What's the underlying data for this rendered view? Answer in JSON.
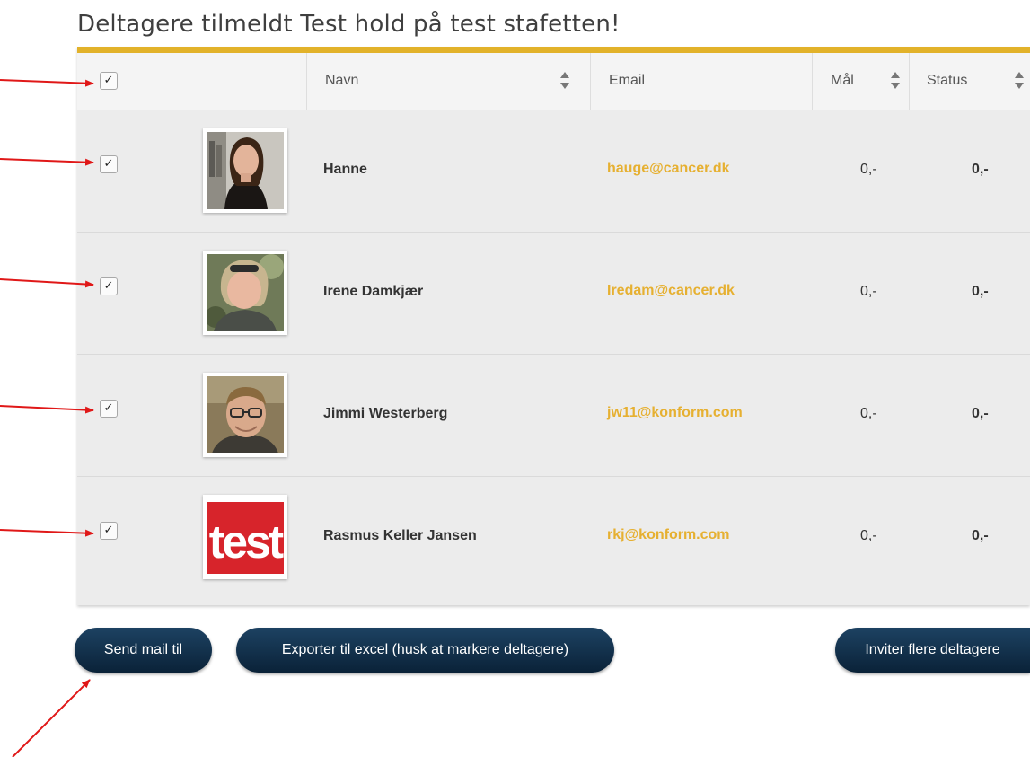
{
  "page": {
    "title": "Deltagere tilmeldt Test hold på test stafetten!"
  },
  "table": {
    "select_all_checked": true,
    "check_glyph": "✓",
    "columns": {
      "name": "Navn",
      "email": "Email",
      "goal": "Mål",
      "status": "Status"
    },
    "rows": [
      {
        "checked": true,
        "name": "Hanne",
        "email": "hauge@cancer.dk",
        "goal": "0,-",
        "status": "0,-",
        "avatar": "woman-portrait"
      },
      {
        "checked": true,
        "name": "Irene Damkjær",
        "email": "Iredam@cancer.dk",
        "goal": "0,-",
        "status": "0,-",
        "avatar": "woman-portrait-sunglasses"
      },
      {
        "checked": true,
        "name": "Jimmi Westerberg",
        "email": "jw11@konform.com",
        "goal": "0,-",
        "status": "0,-",
        "avatar": "man-portrait-glasses"
      },
      {
        "checked": true,
        "name": "Rasmus Keller Jansen",
        "email": "rkj@konform.com",
        "goal": "0,-",
        "status": "0,-",
        "avatar": "test-logo"
      }
    ]
  },
  "logo_text": "test",
  "buttons": {
    "send_mail": "Send mail til",
    "export_excel": "Exporter til excel (husk at markere deltagere)",
    "invite": "Inviter flere deltagere"
  },
  "colors": {
    "accent": "#e2b22a",
    "email": "#e6b031",
    "button": "#0f2c47",
    "annotation_arrow": "#e01818"
  }
}
